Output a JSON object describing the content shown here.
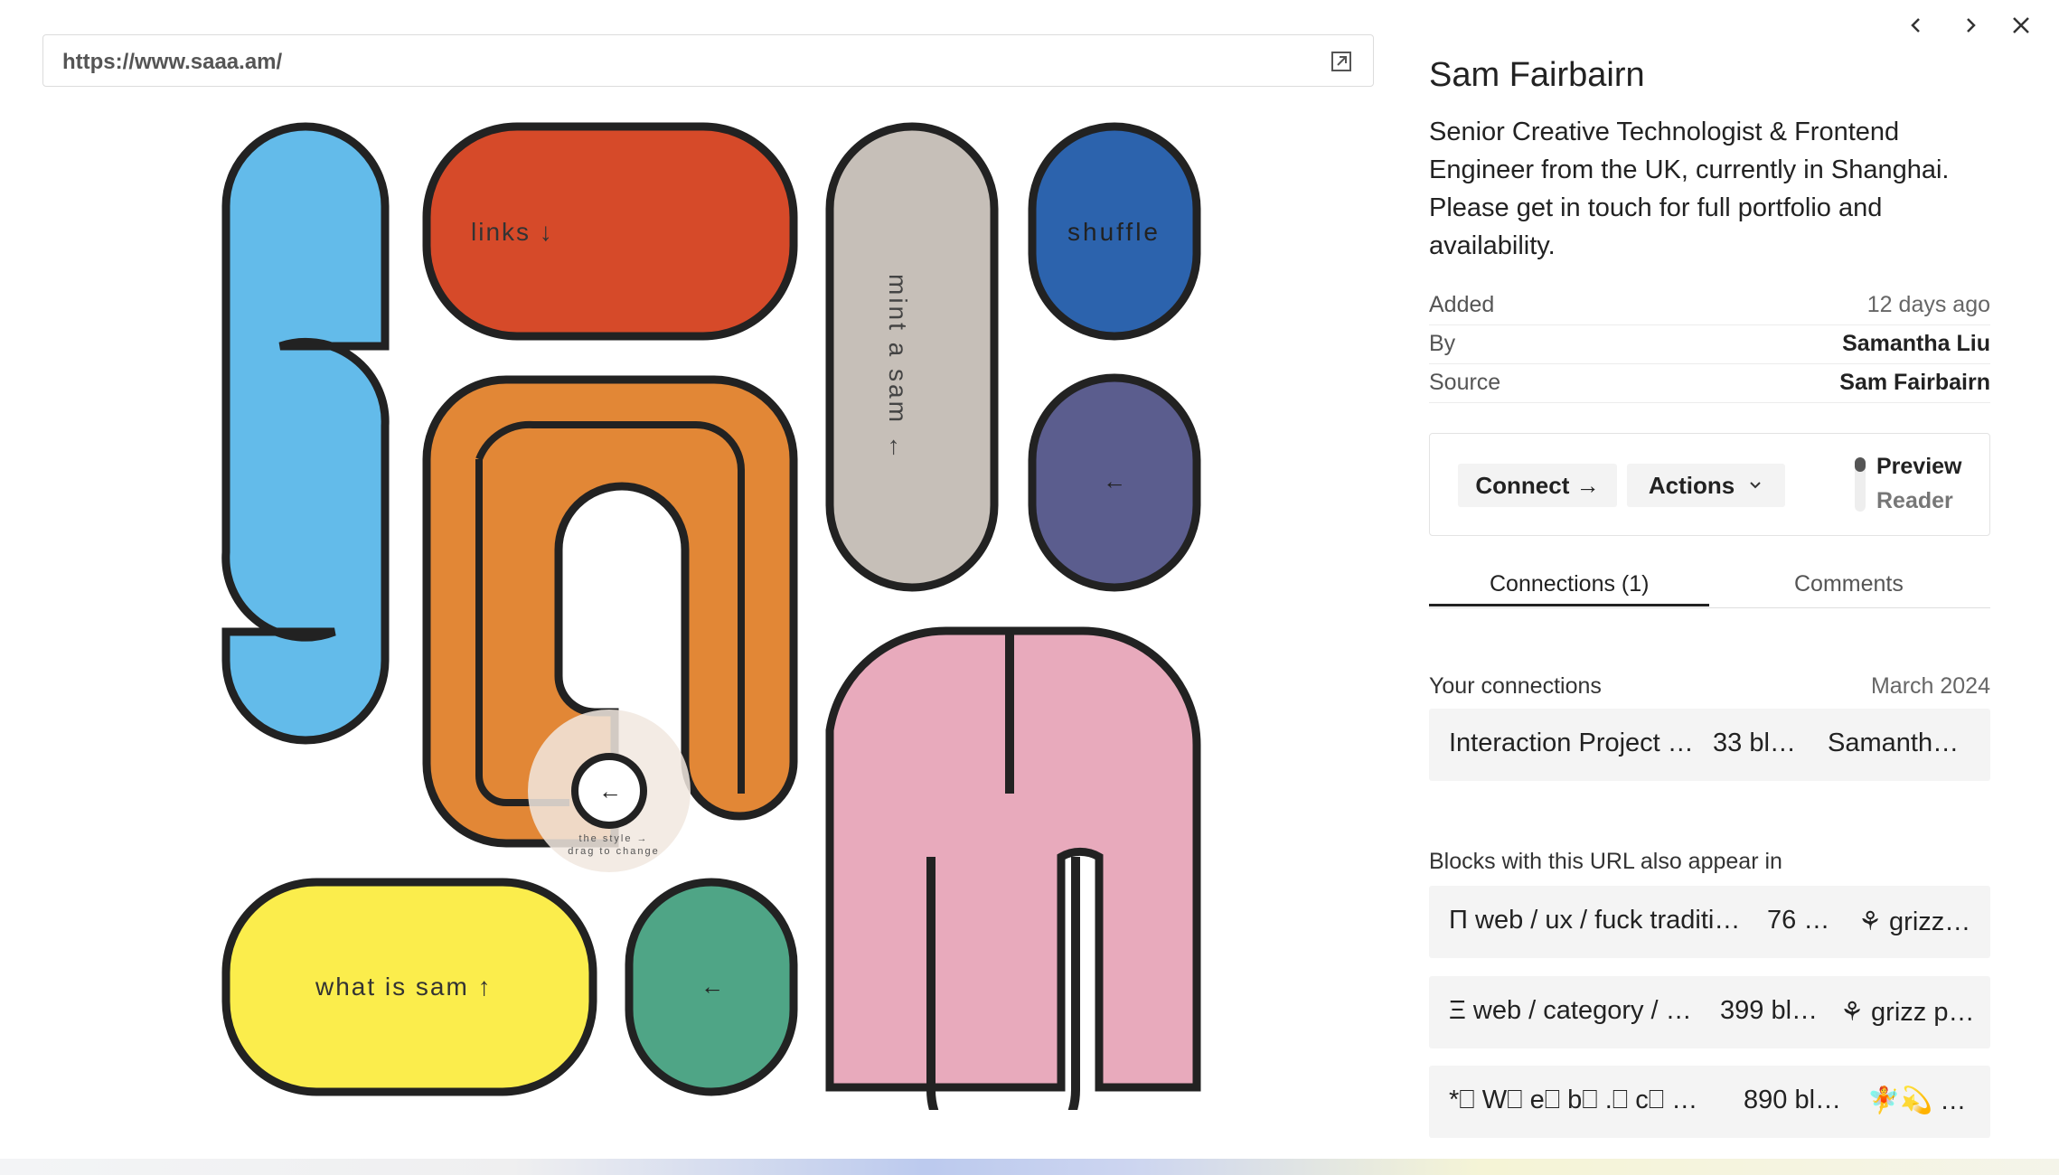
{
  "url": "https://www.saaa.am/",
  "site": {
    "links_label": "links ↓",
    "shuffle_label": "shuffle",
    "mint_label": "mint a sam ←",
    "arrow_label": "←",
    "what_label": "what is sam ↑",
    "dial_text": "the style → drag to change",
    "colors": {
      "blue": "#63bbea",
      "red": "#d64a29",
      "grey": "#c6bfb8",
      "navy": "#2c63ad",
      "purple": "#5b5d8e",
      "orange": "#e28736",
      "pink": "#e8aabc",
      "yellow": "#fbed4c",
      "green": "#4fa586",
      "stroke": "#222222"
    }
  },
  "panel": {
    "title": "Sam Fairbairn",
    "description": "Senior Creative Technologist & Frontend Engineer from the UK, currently in Shanghai. Please get in touch for full portfolio and availability.",
    "meta": {
      "added_label": "Added",
      "added_value": "12 days ago",
      "by_label": "By",
      "by_value": "Samantha Liu",
      "source_label": "Source",
      "source_value": "Sam Fairbairn"
    },
    "actions": {
      "connect": "Connect →",
      "actions": "Actions",
      "preview": "Preview",
      "reader": "Reader"
    },
    "tabs": {
      "connections": "Connections (1)",
      "comments": "Comments"
    },
    "your_connections": {
      "heading": "Your connections",
      "date": "March 2024",
      "item": {
        "title": "Interaction Project …",
        "count": "33 bl…",
        "owner": "Samanth…"
      }
    },
    "also_appear": {
      "heading": "Blocks with this URL also appear in",
      "items": [
        {
          "title": "Π web / ux / fuck traditi…",
          "count": "76 …",
          "owner": "⚘ grizz…"
        },
        {
          "title": "Ξ web / category / …",
          "count": "399 bl…",
          "owner": "⚘ grizz p…"
        },
        {
          "title": "*⎕ W⎕ e⎕ b⎕ .⎕ c⎕ …",
          "count": "890 bl…",
          "owner": "🧚💫 …"
        }
      ]
    }
  }
}
